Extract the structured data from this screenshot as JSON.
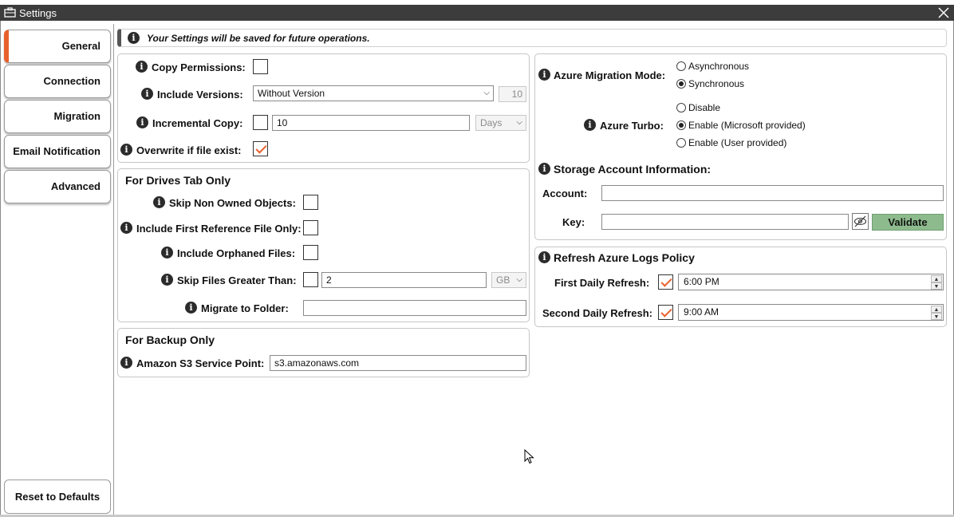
{
  "window": {
    "title": "Settings"
  },
  "sidebar": {
    "items": [
      {
        "label": "General",
        "active": true
      },
      {
        "label": "Connection",
        "active": false
      },
      {
        "label": "Migration",
        "active": false
      },
      {
        "label": "Email Notification",
        "active": false
      },
      {
        "label": "Advanced",
        "active": false
      }
    ],
    "reset_label": "Reset to Defaults"
  },
  "info_banner": "Your Settings will be saved for future operations.",
  "general": {
    "copy_permissions": {
      "label": "Copy Permissions:",
      "checked": false
    },
    "include_versions": {
      "label": "Include Versions:",
      "selected": "Without Version",
      "count": "10"
    },
    "incremental_copy": {
      "label": "Incremental Copy:",
      "checked": false,
      "value": "10",
      "unit": "Days"
    },
    "overwrite": {
      "label": "Overwrite if file exist:",
      "checked": true
    }
  },
  "drives": {
    "title": "For Drives Tab Only",
    "skip_non_owned": {
      "label": "Skip Non Owned Objects:",
      "checked": false
    },
    "first_reference": {
      "label": "Include First Reference File Only:",
      "checked": false
    },
    "orphaned": {
      "label": "Include Orphaned Files:",
      "checked": false
    },
    "skip_greater": {
      "label": "Skip Files Greater Than:",
      "checked": false,
      "value": "2",
      "unit": "GB"
    },
    "migrate_folder": {
      "label": "Migrate to Folder:",
      "value": ""
    }
  },
  "backup": {
    "title": "For Backup Only",
    "s3_label": "Amazon S3 Service Point:",
    "s3_value": "s3.amazonaws.com"
  },
  "azure": {
    "mode_label": "Azure Migration Mode:",
    "mode_options": [
      "Asynchronous",
      "Synchronous"
    ],
    "mode_selected": "Synchronous",
    "turbo_label": "Azure Turbo:",
    "turbo_options": [
      "Disable",
      "Enable (Microsoft provided)",
      "Enable (User provided)"
    ],
    "turbo_selected": "Enable (Microsoft provided)",
    "storage_title": "Storage Account Information:",
    "account_label": "Account:",
    "account_value": "",
    "key_label": "Key:",
    "key_value": "",
    "validate_label": "Validate"
  },
  "logs": {
    "title": "Refresh Azure Logs Policy",
    "first_label": "First Daily Refresh:",
    "first_checked": true,
    "first_time": "6:00 PM",
    "second_label": "Second Daily Refresh:",
    "second_checked": true,
    "second_time": "9:00 AM"
  },
  "colors": {
    "accent": "#e8602c",
    "validate": "#8dbb8d",
    "titlebar": "#3c3c3c"
  },
  "icons": [
    "briefcase-icon",
    "close-icon",
    "info-icon",
    "dropdown-arrow-icon",
    "eye-slash-icon",
    "spinner-arrows-icon",
    "mouse-cursor-icon"
  ]
}
